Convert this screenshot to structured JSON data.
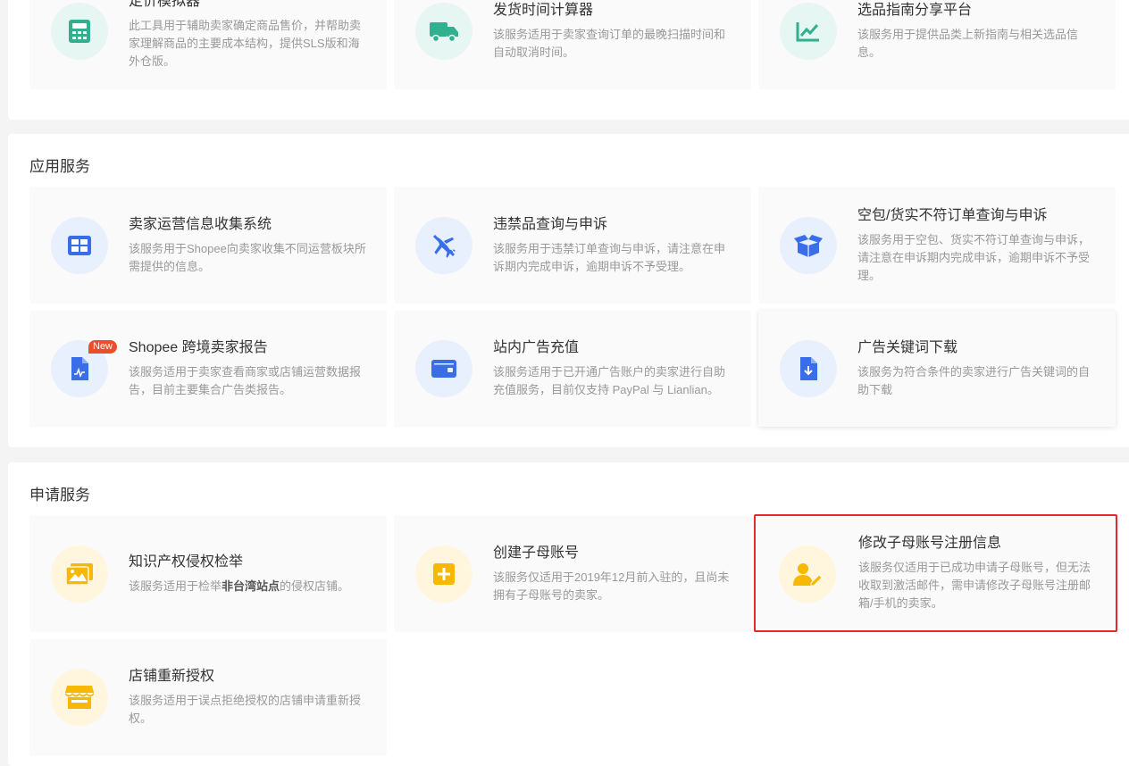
{
  "colors": {
    "teal_icon": "#30b08f",
    "blue_icon": "#3a6ee8",
    "yellow_icon": "#f6b800",
    "selected_border": "#e22a2f",
    "badge_new": "#ee4d2d"
  },
  "top_section": {
    "cards": [
      {
        "title": "定价模拟器",
        "desc": "此工具用于辅助卖家确定商品售价，并帮助卖家理解商品的主要成本结构，提供SLS版和海外仓版。",
        "icon": "calculator-icon"
      },
      {
        "title": "发货时间计算器",
        "desc": "该服务适用于卖家查询订单的最晚扫描时间和自动取消时间。",
        "icon": "truck-icon"
      },
      {
        "title": "选品指南分享平台",
        "desc": "该服务用于提供品类上新指南与相关选品信息。",
        "icon": "trend-chart-icon"
      }
    ]
  },
  "app_section": {
    "title": "应用服务",
    "cards": [
      {
        "title": "卖家运营信息收集系统",
        "desc": "该服务用于Shopee向卖家收集不同运营板块所需提供的信息。",
        "icon": "grid-table-icon"
      },
      {
        "title": "违禁品查询与申诉",
        "desc": "该服务用于违禁订单查询与申诉，请注意在申诉期内完成申诉，逾期申诉不予受理。",
        "icon": "plane-forbidden-icon"
      },
      {
        "title": "空包/货实不符订单查询与申诉",
        "desc": "该服务用于空包、货实不符订单查询与申诉，请注意在申诉期内完成申诉，逾期申诉不予受理。",
        "icon": "open-box-icon"
      },
      {
        "title": "Shopee 跨境卖家报告",
        "desc": "该服务适用于卖家查看商家或店铺运营数据报告，目前主要集合广告类报告。",
        "icon": "report-document-icon",
        "badge": "New"
      },
      {
        "title": "站内广告充值",
        "desc": "该服务适用于已开通广告账户的卖家进行自助充值服务，目前仅支持 PayPal 与 Lianlian。",
        "icon": "wallet-icon"
      },
      {
        "title": "广告关键词下载",
        "desc": "该服务为符合条件的卖家进行广告关键词的自助下载",
        "icon": "download-file-icon"
      }
    ]
  },
  "apply_section": {
    "title": "申请服务",
    "cards": [
      {
        "title": "知识产权侵权检举",
        "desc_pre": "该服务适用于检举",
        "desc_bold": "非台湾站点",
        "desc_post": "的侵权店铺。",
        "icon": "image-gallery-icon"
      },
      {
        "title": "创建子母账号",
        "desc": "该服务仅适用于2019年12月前入驻的，且尚未拥有子母账号的卖家。",
        "icon": "plus-square-icon"
      },
      {
        "title": "修改子母账号注册信息",
        "desc": "该服务仅适用于已成功申请子母账号，但无法收取到激活邮件，需申请修改子母账号注册邮箱/手机的卖家。",
        "icon": "user-edit-icon"
      },
      {
        "title": "店铺重新授权",
        "desc": "该服务适用于误点拒绝授权的店铺申请重新授权。",
        "icon": "storefront-icon"
      }
    ]
  }
}
